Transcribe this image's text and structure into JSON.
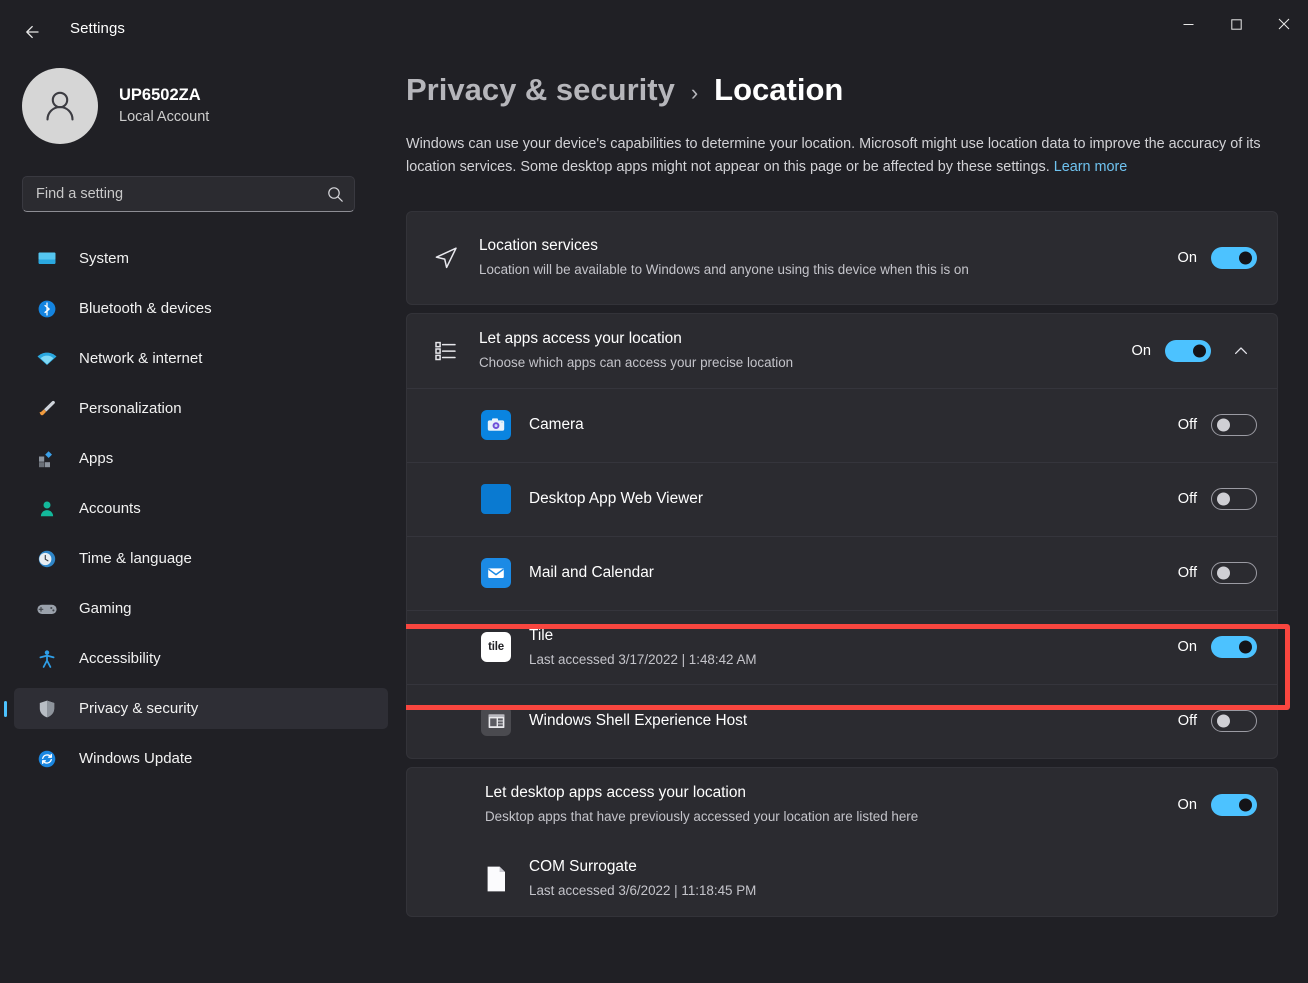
{
  "window": {
    "title": "Settings",
    "back_icon": "back-arrow-icon",
    "minimize_label": "Minimize",
    "maximize_label": "Maximize",
    "close_label": "Close"
  },
  "account": {
    "name": "UP6502ZA",
    "type": "Local Account",
    "avatar_icon": "person-avatar-icon"
  },
  "search": {
    "placeholder": "Find a setting",
    "value": "",
    "icon": "search-icon"
  },
  "sidebar": {
    "items": [
      {
        "label": "System",
        "icon": "monitor-icon",
        "selected": false
      },
      {
        "label": "Bluetooth & devices",
        "icon": "bluetooth-icon",
        "selected": false
      },
      {
        "label": "Network & internet",
        "icon": "wifi-icon",
        "selected": false
      },
      {
        "label": "Personalization",
        "icon": "paintbrush-icon",
        "selected": false
      },
      {
        "label": "Apps",
        "icon": "apps-grid-icon",
        "selected": false
      },
      {
        "label": "Accounts",
        "icon": "person-icon",
        "selected": false
      },
      {
        "label": "Time & language",
        "icon": "clock-globe-icon",
        "selected": false
      },
      {
        "label": "Gaming",
        "icon": "gamepad-icon",
        "selected": false
      },
      {
        "label": "Accessibility",
        "icon": "accessibility-person-icon",
        "selected": false
      },
      {
        "label": "Privacy & security",
        "icon": "shield-icon",
        "selected": true
      },
      {
        "label": "Windows Update",
        "icon": "refresh-circle-icon",
        "selected": false
      }
    ]
  },
  "page": {
    "breadcrumb_parent": "Privacy & security",
    "breadcrumb_separator": "›",
    "breadcrumb_current": "Location",
    "description": "Windows can use your device's capabilities to determine your location. Microsoft might use location data to improve the accuracy of its location services. Some desktop apps might not appear on this page or be affected by these settings.",
    "learn_more": "Learn more"
  },
  "location_services": {
    "icon": "location-arrow-icon",
    "title": "Location services",
    "subtitle": "Location will be available to Windows and anyone using this device when this is on",
    "toggle_state": "On",
    "toggle_on": true
  },
  "apps_access": {
    "icon": "list-settings-icon",
    "title": "Let apps access your location",
    "subtitle": "Choose which apps can access your precise location",
    "toggle_state": "On",
    "toggle_on": true,
    "expand_icon": "chevron-up-icon",
    "apps": [
      {
        "name": "Camera",
        "icon": "camera-app-icon",
        "toggle_state": "Off",
        "toggle_on": false,
        "last_accessed": ""
      },
      {
        "name": "Desktop App Web Viewer",
        "icon": "web-viewer-app-icon",
        "toggle_state": "Off",
        "toggle_on": false,
        "last_accessed": ""
      },
      {
        "name": "Mail and Calendar",
        "icon": "mail-app-icon",
        "toggle_state": "Off",
        "toggle_on": false,
        "last_accessed": ""
      },
      {
        "name": "Tile",
        "icon": "tile-app-icon",
        "toggle_state": "On",
        "toggle_on": true,
        "last_accessed": "Last accessed 3/17/2022  |  1:48:42 AM"
      },
      {
        "name": "Windows Shell Experience Host",
        "icon": "shell-host-app-icon",
        "toggle_state": "Off",
        "toggle_on": false,
        "last_accessed": ""
      }
    ]
  },
  "desktop_access": {
    "title": "Let desktop apps access your location",
    "subtitle": "Desktop apps that have previously accessed your location are listed here",
    "toggle_state": "On",
    "toggle_on": true,
    "apps": [
      {
        "name": "COM Surrogate",
        "icon": "document-icon",
        "last_accessed": "Last accessed 3/6/2022  |  11:18:45 PM"
      }
    ]
  },
  "annotation": {
    "target": "Tile",
    "color": "#f9463f"
  },
  "colors": {
    "page_background": "#202025",
    "card_background": "#2b2b30",
    "accent": "#4cc2ff",
    "link": "#6fc3f0",
    "annotation": "#f9463f"
  }
}
